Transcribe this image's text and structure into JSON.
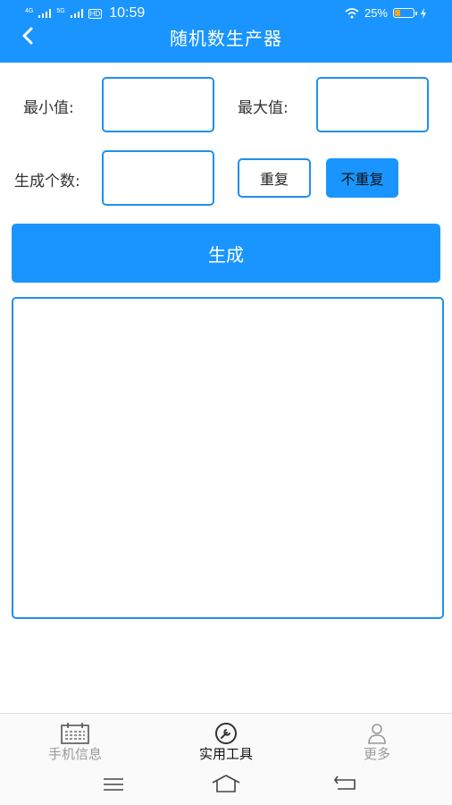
{
  "status": {
    "net1": "4G",
    "net2": "5G",
    "hd": "HD",
    "time": "10:59",
    "battery": "25%"
  },
  "header": {
    "title": "随机数生产器"
  },
  "form": {
    "min_label": "最小值:",
    "max_label": "最大值:",
    "count_label": "生成个数:",
    "repeat_label": "重复",
    "norepeat_label": "不重复",
    "min_value": "",
    "max_value": "",
    "count_value": "",
    "generate_label": "生成",
    "result_value": ""
  },
  "tabs": [
    {
      "label": "手机信息",
      "icon": "calendar-icon",
      "active": false
    },
    {
      "label": "实用工具",
      "icon": "wrench-icon",
      "active": true
    },
    {
      "label": "更多",
      "icon": "person-icon",
      "active": false
    }
  ],
  "colors": {
    "accent": "#1a95ff",
    "border": "#2090e8",
    "inactive": "#9a9a9a",
    "active": "#111111"
  }
}
